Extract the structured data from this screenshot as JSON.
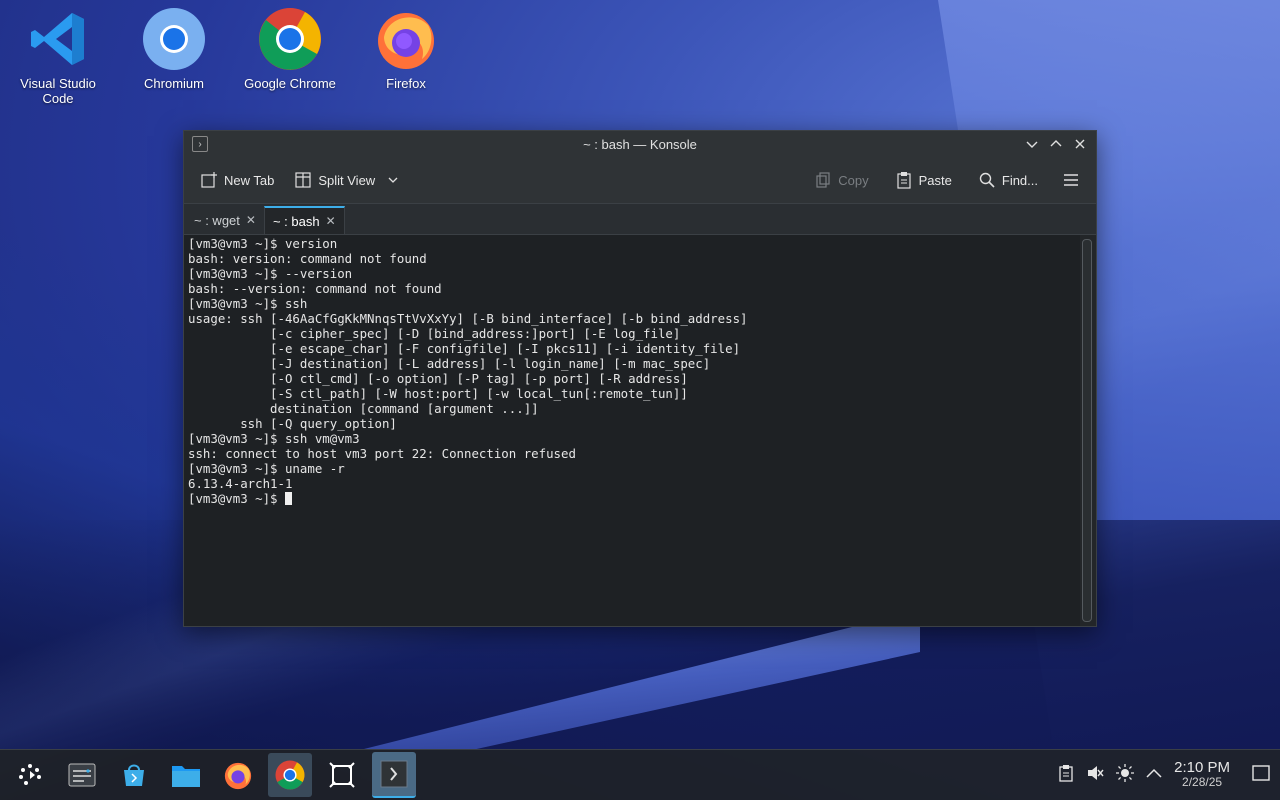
{
  "desktop": {
    "icons": [
      {
        "label": "Visual Studio Code",
        "icon": "vscode-icon"
      },
      {
        "label": "Chromium",
        "icon": "chromium-icon"
      },
      {
        "label": "Google Chrome",
        "icon": "chrome-icon"
      },
      {
        "label": "Firefox",
        "icon": "firefox-icon"
      }
    ]
  },
  "window": {
    "title": "~ : bash — Konsole",
    "toolbar": {
      "new_tab": "New Tab",
      "split_view": "Split View",
      "copy": "Copy",
      "paste": "Paste",
      "find": "Find..."
    },
    "tabs": [
      {
        "label": "~ : wget",
        "active": false
      },
      {
        "label": "~ : bash",
        "active": true
      }
    ],
    "terminal_lines": [
      "[vm3@vm3 ~]$ version",
      "bash: version: command not found",
      "[vm3@vm3 ~]$ --version",
      "bash: --version: command not found",
      "[vm3@vm3 ~]$ ssh",
      "usage: ssh [-46AaCfGgKkMNnqsTtVvXxYy] [-B bind_interface] [-b bind_address]",
      "           [-c cipher_spec] [-D [bind_address:]port] [-E log_file]",
      "           [-e escape_char] [-F configfile] [-I pkcs11] [-i identity_file]",
      "           [-J destination] [-L address] [-l login_name] [-m mac_spec]",
      "           [-O ctl_cmd] [-o option] [-P tag] [-p port] [-R address]",
      "           [-S ctl_path] [-W host:port] [-w local_tun[:remote_tun]]",
      "           destination [command [argument ...]]",
      "       ssh [-Q query_option]",
      "[vm3@vm3 ~]$ ssh vm@vm3",
      "ssh: connect to host vm3 port 22: Connection refused",
      "[vm3@vm3 ~]$ uname -r",
      "6.13.4-arch1-1"
    ],
    "prompt": "[vm3@vm3 ~]$ "
  },
  "taskbar": {
    "apps": [
      "app-launcher-icon",
      "overview-icon",
      "discover-icon",
      "dolphin-icon",
      "firefox-icon",
      "chrome-icon",
      "window-manager-icon",
      "konsole-icon"
    ],
    "clock_time": "2:10 PM",
    "clock_date": "2/28/25"
  },
  "colors": {
    "accent": "#3daee9",
    "terminal_bg": "#1e2124",
    "terminal_fg": "#e6e6e6"
  }
}
